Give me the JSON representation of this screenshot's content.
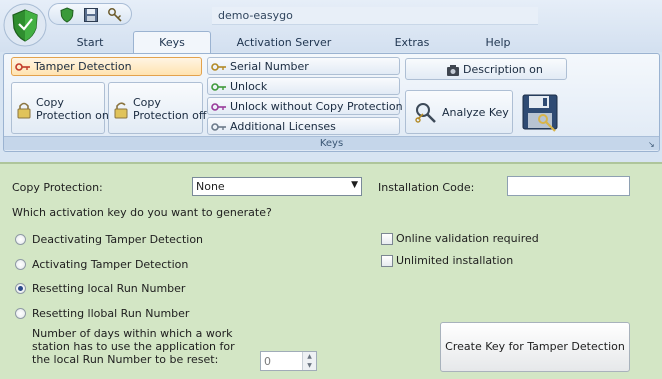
{
  "window": {
    "title": "demo-easygo"
  },
  "tabs": [
    {
      "label": "Start"
    },
    {
      "label": "Keys"
    },
    {
      "label": "Activation Server"
    },
    {
      "label": "Extras"
    },
    {
      "label": "Help"
    }
  ],
  "ribbon": {
    "group_label": "Keys",
    "buttons": {
      "tamper_detection": "Tamper Detection",
      "copy_protection_on": "Copy\nProtection on",
      "copy_protection_off": "Copy\nProtection off",
      "serial_number": "Serial Number",
      "unlock": "Unlock",
      "unlock_without_copy": "Unlock without Copy Protection",
      "additional_licenses": "Additional Licenses",
      "description_on": "Description on",
      "analyze_key": "Analyze Key"
    }
  },
  "form": {
    "copy_protection_label": "Copy Protection:",
    "copy_protection_value": "None",
    "installation_code_label": "Installation Code:",
    "installation_code_value": "",
    "question": "Which activation key do you want to generate?",
    "radios": [
      {
        "label": "Deactivating Tamper Detection",
        "checked": false
      },
      {
        "label": "Activating Tamper Detection",
        "checked": false
      },
      {
        "label": "Resetting local Run Number",
        "checked": true
      },
      {
        "label": "Resetting llobal Run Number",
        "checked": false
      }
    ],
    "checkboxes": [
      {
        "label": "Online validation required",
        "checked": false
      },
      {
        "label": "Unlimited installation",
        "checked": false
      }
    ],
    "days_label": "Number of days within which a work station has to use the application for the local Run Number to be reset:",
    "days_value": "0",
    "create_button": "Create Key for Tamper Detection"
  },
  "colors": {
    "ribbon_selected_border": "#e3a24d",
    "form_background": "#d3e6c5",
    "radio_dot": "#2c4a8a"
  }
}
